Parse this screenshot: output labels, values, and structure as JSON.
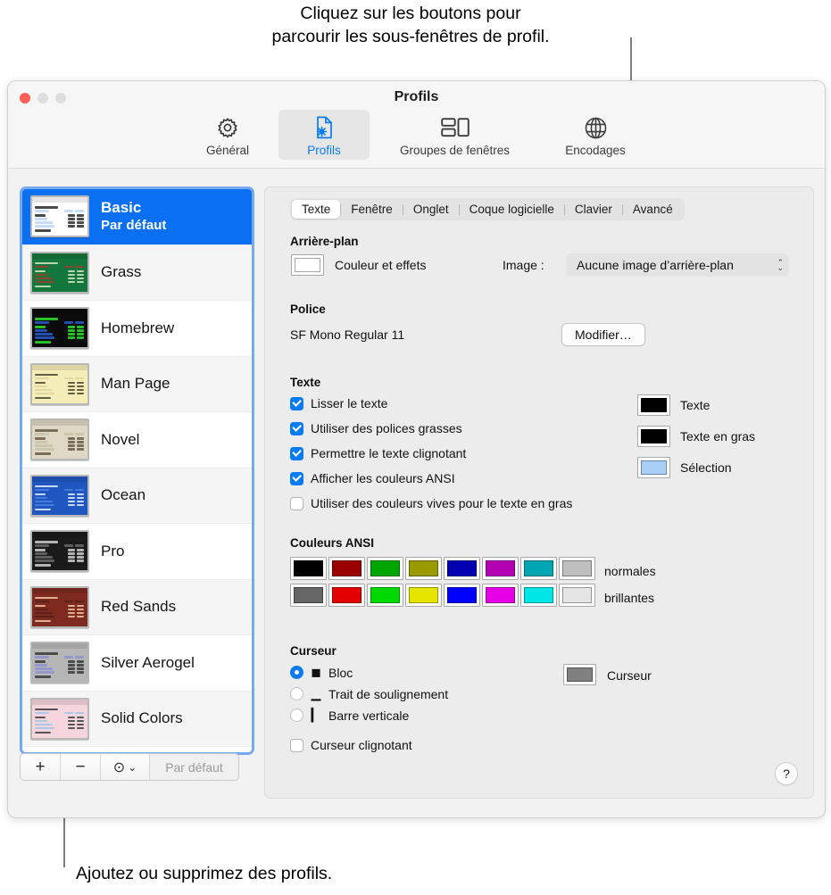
{
  "callouts": {
    "top": "Cliquez sur les boutons pour\nparcourir les sous-fenêtres de profil.",
    "bottom": "Ajoutez ou supprimez des profils."
  },
  "window": {
    "title": "Profils",
    "toolbar": [
      {
        "label": "Général",
        "icon": "gear-icon",
        "selected": false
      },
      {
        "label": "Profils",
        "icon": "document-gear-icon",
        "selected": true
      },
      {
        "label": "Groupes de fenêtres",
        "icon": "window-groups-icon",
        "selected": false
      },
      {
        "label": "Encodages",
        "icon": "globe-icon",
        "selected": false
      }
    ]
  },
  "sidebar": {
    "profiles": [
      {
        "name": "Basic",
        "subtitle": "Par défaut",
        "selected": true,
        "thumb": {
          "bg": "#ffffff",
          "fg": "#2a2a2a",
          "accent": "#bcd7f5"
        }
      },
      {
        "name": "Grass",
        "subtitle": "",
        "selected": false,
        "thumb": {
          "bg": "#13773d",
          "fg": "#d8e8c0",
          "accent": "#a33a2a"
        }
      },
      {
        "name": "Homebrew",
        "subtitle": "",
        "selected": false,
        "thumb": {
          "bg": "#0b0b0b",
          "fg": "#2ee02e",
          "accent": "#2a5bd0"
        }
      },
      {
        "name": "Man Page",
        "subtitle": "",
        "selected": false,
        "thumb": {
          "bg": "#f5edb8",
          "fg": "#4a4430",
          "accent": "#ded4a0"
        }
      },
      {
        "name": "Novel",
        "subtitle": "",
        "selected": false,
        "thumb": {
          "bg": "#ded9c4",
          "fg": "#6a5a46",
          "accent": "#c9c2a8"
        }
      },
      {
        "name": "Ocean",
        "subtitle": "",
        "selected": false,
        "thumb": {
          "bg": "#2056c0",
          "fg": "#e6eeff",
          "accent": "#4b80e0"
        }
      },
      {
        "name": "Pro",
        "subtitle": "",
        "selected": false,
        "thumb": {
          "bg": "#1a1a1a",
          "fg": "#cfcfcf",
          "accent": "#6b6b6b"
        }
      },
      {
        "name": "Red Sands",
        "subtitle": "",
        "selected": false,
        "thumb": {
          "bg": "#7e2a20",
          "fg": "#f0c8a0",
          "accent": "#53201a"
        }
      },
      {
        "name": "Silver Aerogel",
        "subtitle": "",
        "selected": false,
        "thumb": {
          "bg": "#b6b6b6",
          "fg": "#3a3a3a",
          "accent": "#8f93d0"
        }
      },
      {
        "name": "Solid Colors",
        "subtitle": "",
        "selected": false,
        "thumb": {
          "bg": "#f6d5dd",
          "fg": "#3b3b3b",
          "accent": "#9fc4ea"
        }
      }
    ],
    "toolbar": {
      "add": "+",
      "remove": "−",
      "actions": "⊙",
      "actions_chevron": "⌄",
      "default_button": "Par défaut"
    }
  },
  "pane": {
    "tabs": [
      {
        "label": "Texte",
        "active": true
      },
      {
        "label": "Fenêtre",
        "active": false
      },
      {
        "label": "Onglet",
        "active": false
      },
      {
        "label": "Coque logicielle",
        "active": false
      },
      {
        "label": "Clavier",
        "active": false
      },
      {
        "label": "Avancé",
        "active": false
      }
    ],
    "background": {
      "title": "Arrière-plan",
      "color_label": "Couleur et effets",
      "color_swatch": "#ffffff",
      "image_label": "Image :",
      "image_value": "Aucune image d’arrière-plan"
    },
    "font": {
      "title": "Police",
      "value": "SF Mono Regular 11",
      "change_button": "Modifier…"
    },
    "text": {
      "title": "Texte",
      "checkboxes": [
        {
          "label": "Lisser le texte",
          "checked": true
        },
        {
          "label": "Utiliser des polices grasses",
          "checked": true
        },
        {
          "label": "Permettre le texte clignotant",
          "checked": true
        },
        {
          "label": "Afficher les couleurs ANSI",
          "checked": true
        },
        {
          "label": "Utiliser des couleurs vives pour le texte en gras",
          "checked": false
        }
      ],
      "wells": [
        {
          "label": "Texte",
          "color": "#000000"
        },
        {
          "label": "Texte en gras",
          "color": "#000000"
        },
        {
          "label": "Sélection",
          "color": "#a8cff5"
        }
      ]
    },
    "ansi": {
      "title": "Couleurs ANSI",
      "normal_label": "normales",
      "bright_label": "brillantes",
      "normal": [
        "#000000",
        "#990000",
        "#00a600",
        "#999900",
        "#0000b2",
        "#b200b2",
        "#00a6b2",
        "#bfbfbf"
      ],
      "bright": [
        "#666666",
        "#e50000",
        "#00d900",
        "#e5e500",
        "#0000ff",
        "#e500e5",
        "#00e5e5",
        "#e5e5e5"
      ]
    },
    "cursor": {
      "title": "Curseur",
      "options": [
        {
          "label": "Bloc",
          "glyph": "◼",
          "selected": true
        },
        {
          "label": "Trait de soulignement",
          "glyph": "▁",
          "selected": false
        },
        {
          "label": "Barre verticale",
          "glyph": "▎",
          "selected": false
        }
      ],
      "blink": {
        "label": "Curseur clignotant",
        "checked": false
      },
      "well": {
        "label": "Curseur",
        "color": "#808080"
      }
    },
    "help": "?"
  }
}
